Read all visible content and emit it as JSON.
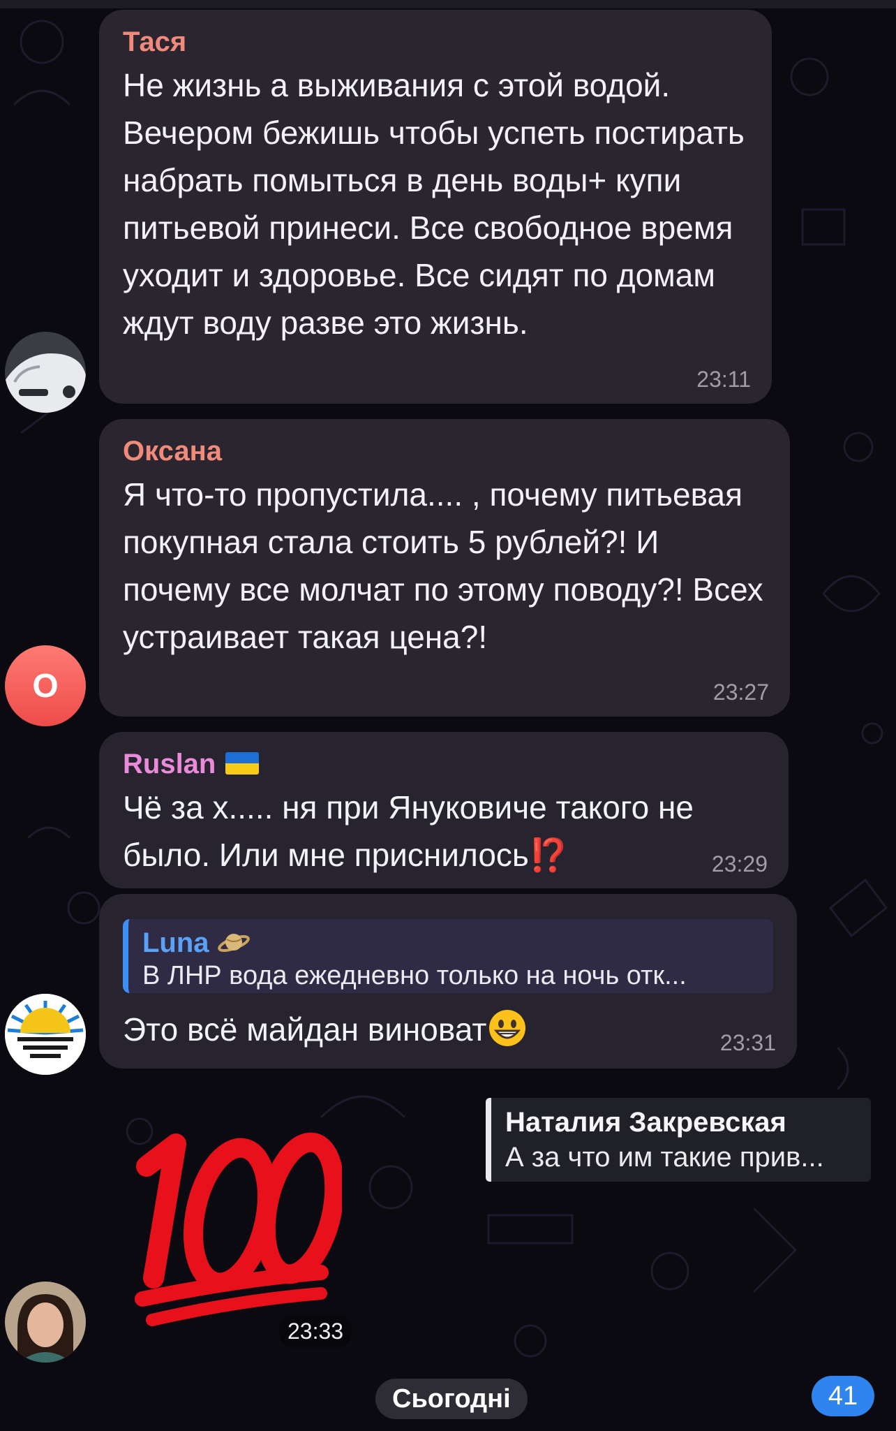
{
  "messages": [
    {
      "sender": "Тася",
      "sender_color": "#f08b7c",
      "text": "Не жизнь а выживания с этой водой. Вечером бежишь чтобы успеть постирать набрать помыться в день воды+ купи питьевой принеси. Все свободное время уходит и здоровье. Все сидят по домам ждут воду разве это жизнь.",
      "time": "23:11",
      "avatar_icon": "car-photo-avatar"
    },
    {
      "sender": "Оксана",
      "sender_color": "#f08b7c",
      "text": "Я что-то пропустила.... , почему питьевая покупная стала стоить 5 рублей?! И почему все молчат по этому поводу?! Всех устраивает такая цена?!",
      "time": "23:27",
      "avatar_letter": "О"
    },
    {
      "sender": "Ruslan",
      "sender_color": "#e98bd8",
      "text": "Чё за х..... ня при Януковиче такого не было. Или мне приснилось",
      "emoji": "⁉️",
      "time": "23:29"
    },
    {
      "quote_name": "Luna",
      "quote_name_color": "#5aa2f7",
      "quote_emoji_icon": "saturn-icon",
      "quote_text": "В ЛНР вода ежедневно только на ночь отк...",
      "text": "Это всё майдан виноват",
      "emoji_icon": "grinning-face-icon",
      "time": "23:31",
      "avatar_icon": "sunrise-logo-avatar"
    }
  ],
  "reply_preview": {
    "name": "Наталия Закревская",
    "text": "А за что им такие прив..."
  },
  "sticker": {
    "icon": "hundred-points-sticker",
    "time": "23:33"
  },
  "date_separator": "Сьогодні",
  "unread_badge": "41",
  "colors": {
    "background": "#0b0a10",
    "bubble": "#2b2530",
    "accent_blue": "#2f84f0",
    "sticker_red": "#e8101b"
  }
}
